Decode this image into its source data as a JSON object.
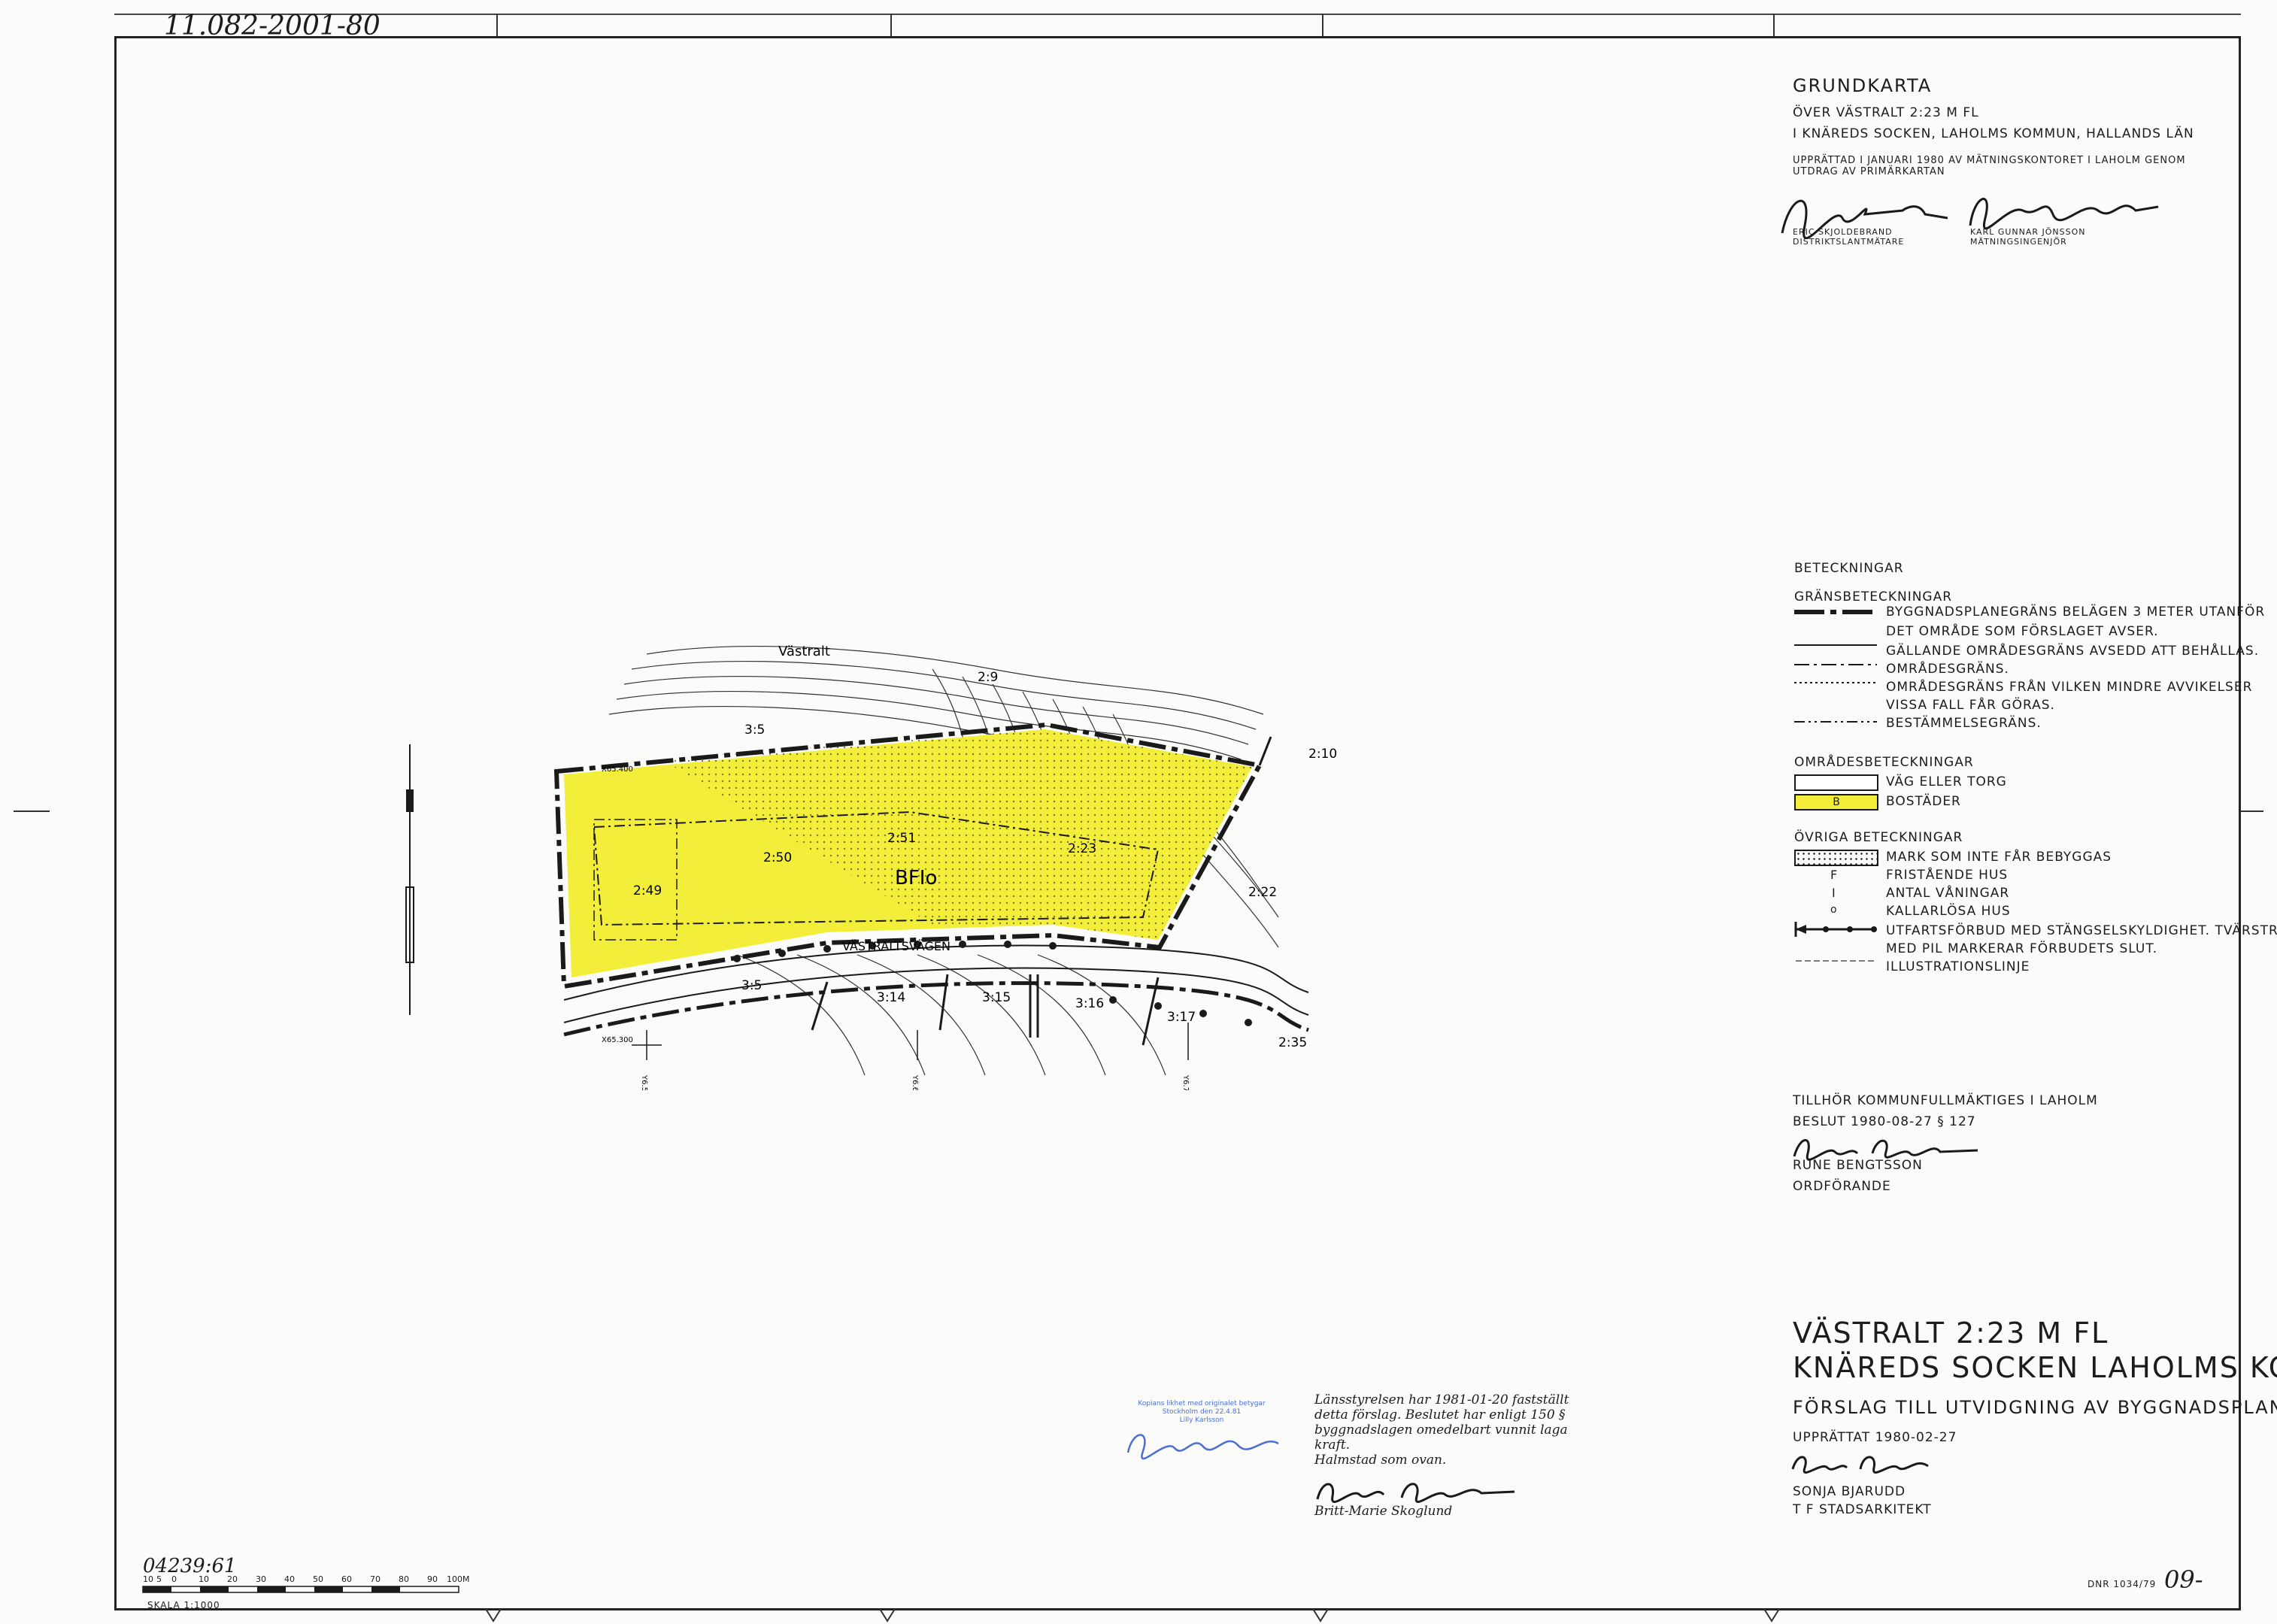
{
  "sheet": {
    "handwritten_id": "11.082-2001-80",
    "archive_number": "04239:61",
    "dnr": "DNR 1034/79",
    "sheet_number": "09-",
    "scale_label": "SKALA 1:1000",
    "scale_ticks": [
      "10",
      "5",
      "0",
      "10",
      "20",
      "30",
      "40",
      "50",
      "60",
      "70",
      "80",
      "90",
      "100M"
    ]
  },
  "header": {
    "title": "GRUNDKARTA",
    "line1": "ÖVER VÄSTRALT 2:23 M FL",
    "line2": "I KNÄREDS SOCKEN, LAHOLMS KOMMUN, HALLANDS LÄN",
    "prepared_line1": "UPPRÄTTAD I JANUARI 1980 AV MÄTNINGSKONTORET I LAHOLM GENOM",
    "prepared_line2": "UTDRAG AV PRIMÄRKARTAN",
    "signer1_name": "ERIC SKJOLDEBRAND",
    "signer1_title": "DISTRIKTSLANTMÄTARE",
    "signer2_name": "KARL GUNNAR JÖNSSON",
    "signer2_title": "MÄTNINGSINGENJÖR"
  },
  "legend": {
    "heading": "BETECKNINGAR",
    "borders_heading": "GRÄNSBETECKNINGAR",
    "borders": [
      "BYGGNADSPLANEGRÄNS BELÄGEN 3 METER UTANFÖR",
      "DET OMRÅDE SOM FÖRSLAGET AVSER.",
      "GÄLLANDE OMRÅDESGRÄNS AVSEDD ATT BEHÅLLAS.",
      "OMRÅDESGRÄNS.",
      "OMRÅDESGRÄNS FRÅN VILKEN MINDRE AVVIKELSER",
      "VISSA FALL FÅR GÖRAS.",
      "BESTÄMMELSEGRÄNS."
    ],
    "areas_heading": "OMRÅDESBETECKNINGAR",
    "areas": [
      {
        "symbol": "",
        "label": "VÄG ELLER TORG"
      },
      {
        "symbol": "B",
        "label": "BOSTÄDER"
      }
    ],
    "other_heading": "ÖVRIGA BETECKNINGAR",
    "other": [
      {
        "symbol": "",
        "label": "MARK SOM INTE FÅR BEBYGGAS"
      },
      {
        "symbol": "F",
        "label": "FRISTÅENDE HUS"
      },
      {
        "symbol": "I",
        "label": "ANTAL VÅNINGAR"
      },
      {
        "symbol": "o",
        "label": "KALLARLÖSA HUS"
      },
      {
        "symbol": "",
        "label": "UTFARTSFÖRBUD MED STÄNGSELSKYLDIGHET. TVÄRSTRECK"
      },
      {
        "symbol": "",
        "label": "MED PIL MARKERAR FÖRBUDETS SLUT."
      },
      {
        "symbol": "",
        "label": "ILLUSTRATIONSLINJE"
      }
    ]
  },
  "decision": {
    "line1": "TILLHÖR KOMMUNFULLMÄKTIGES I LAHOLM",
    "line2": "BESLUT  1980-08-27  § 127",
    "name": "RUNE BENGTSSON",
    "title": "ORDFÖRANDE"
  },
  "county": {
    "lines": [
      "Länsstyrelsen  har  1981-01-20  fastställt",
      "detta  förslag.  Beslutet  har  enligt  150  §",
      "byggnadslagen  omedelbart  vunnit  laga",
      "kraft.",
      "Halmstad  som  ovan."
    ],
    "signer": "Britt-Marie  Skoglund",
    "stamp_line1": "Kopians likhet med originalet betygar",
    "stamp_line2": "Stockholm den 22.4.81",
    "stamp_line3": "Lilly Karlsson"
  },
  "title_block": {
    "name1": "VÄSTRALT  2:23  M FL",
    "name2": "KNÄREDS  SOCKEN  LAHOLMS KOMMUN",
    "subtitle": "FÖRSLAG TILL UTVIDGNING AV BYGGNADSPLAN",
    "date": "UPPRÄTTAT  1980-02-27",
    "name": "SONJA BJARUDD",
    "role": "T F  STADSARKITEKT"
  },
  "map": {
    "place_label": "Västralt",
    "road_label": "VÄSTRALTSVÄGEN",
    "zone_label": "BFIo",
    "parcels": [
      "2:9",
      "3:5",
      "2:10",
      "2:51",
      "2:50",
      "2:23",
      "2:49",
      "2:22",
      "3:5",
      "3:14",
      "3:15",
      "3:16",
      "3:17",
      "2:35"
    ],
    "coords": [
      "X65.400",
      "X65.300",
      "Y6.500",
      "Y6.600",
      "Y6.700"
    ],
    "colors": {
      "fill": "#f2ee3a",
      "line": "#1a1a1a"
    }
  }
}
